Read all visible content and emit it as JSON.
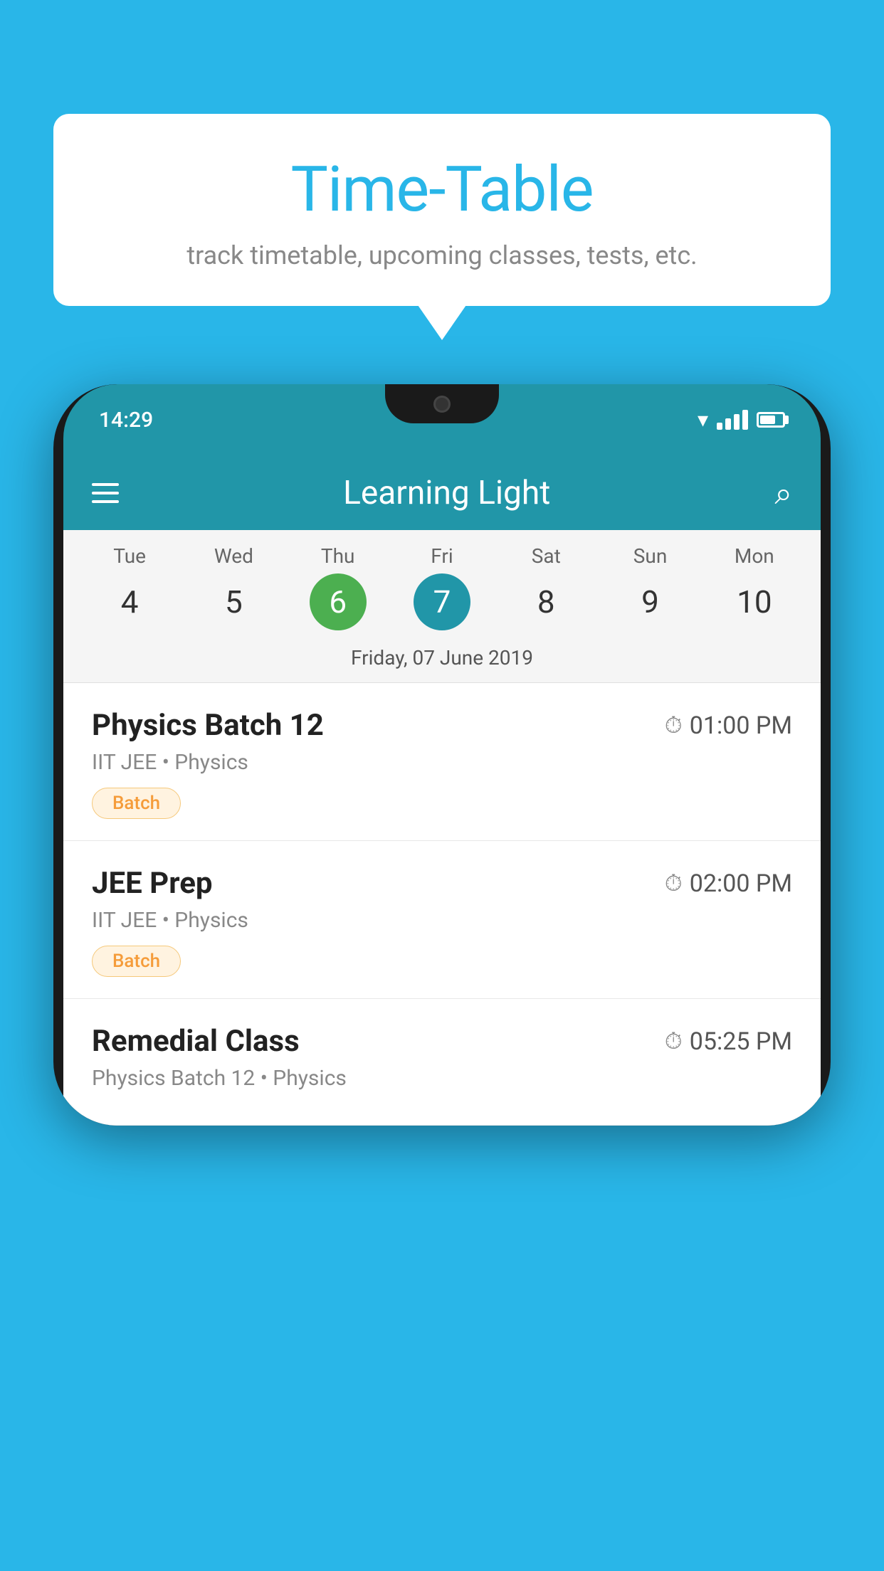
{
  "background": {
    "color": "#29b6e8"
  },
  "speech_bubble": {
    "title": "Time-Table",
    "subtitle": "track timetable, upcoming classes, tests, etc."
  },
  "status_bar": {
    "time": "14:29"
  },
  "app_header": {
    "title": "Learning Light"
  },
  "calendar": {
    "days": [
      {
        "name": "Tue",
        "num": "4",
        "state": "normal"
      },
      {
        "name": "Wed",
        "num": "5",
        "state": "normal"
      },
      {
        "name": "Thu",
        "num": "6",
        "state": "today"
      },
      {
        "name": "Fri",
        "num": "7",
        "state": "selected"
      },
      {
        "name": "Sat",
        "num": "8",
        "state": "normal"
      },
      {
        "name": "Sun",
        "num": "9",
        "state": "normal"
      },
      {
        "name": "Mon",
        "num": "10",
        "state": "normal"
      }
    ],
    "selected_date": "Friday, 07 June 2019"
  },
  "schedule_items": [
    {
      "name": "Physics Batch 12",
      "time": "01:00 PM",
      "sub": "IIT JEE • Physics",
      "tag": "Batch"
    },
    {
      "name": "JEE Prep",
      "time": "02:00 PM",
      "sub": "IIT JEE • Physics",
      "tag": "Batch"
    },
    {
      "name": "Remedial Class",
      "time": "05:25 PM",
      "sub": "Physics Batch 12 • Physics",
      "tag": ""
    }
  ]
}
